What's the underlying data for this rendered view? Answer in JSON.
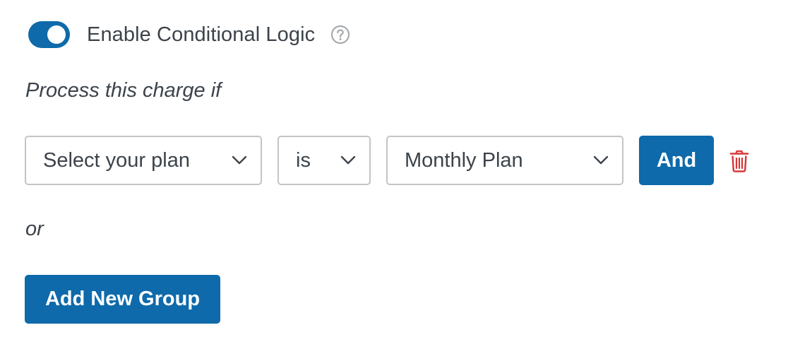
{
  "conditional_logic": {
    "toggle_on": true,
    "label": "Enable Conditional Logic",
    "help_icon": "question-circle-icon"
  },
  "rule_intro": "Process this charge if",
  "rule": {
    "field": "Select your plan",
    "operator": "is",
    "value": "Monthly Plan",
    "and_label": "And",
    "delete_icon": "trash-icon"
  },
  "or_label": "or",
  "add_group_label": "Add New Group",
  "colors": {
    "accent": "#0e6aaa",
    "text": "#3c434a",
    "border": "#c3c4c7",
    "danger": "#d63638",
    "help_icon": "#a7aaad"
  }
}
